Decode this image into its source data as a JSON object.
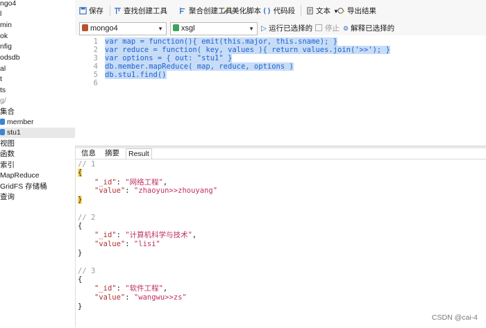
{
  "tree": {
    "items": [
      "ngo4",
      "l",
      "min",
      "ok",
      "nfig",
      "odsdb",
      "al",
      "t",
      "ts",
      "g/",
      "集合",
      "member",
      "stu1",
      "视图",
      "函数",
      "索引",
      "MapReduce",
      "GridFS 存储桶",
      "查询"
    ]
  },
  "toolbar": {
    "save": "保存",
    "find_builder": "查找创建工具",
    "aggregate_builder": "聚合创建工具",
    "beautify": "美化脚本",
    "code_snippet": "代码段",
    "text": "文本",
    "export": "导出结果"
  },
  "selectors": {
    "connection": "mongo4",
    "database": "xsgl",
    "run_selected": "运行已选择的",
    "stop": "停止",
    "explain_selected": "解释已选择的"
  },
  "editor": {
    "line_numbers": [
      "1",
      "2",
      "3",
      "4",
      "5",
      "6"
    ],
    "lines": [
      "var map = function(){ emit(this.major, this.sname); }",
      "var reduce = function( key, values ){ return values.join('>>'); }",
      "var options = { out: \"stu1\" }",
      "db.member.mapReduce( map, reduce, options )",
      "db.stu1.find()",
      ""
    ]
  },
  "result_tabs": [
    "信息",
    "摘要",
    "Result"
  ],
  "results": {
    "docs": [
      {
        "comment": "// 1",
        "id": "\"网络工程\"",
        "value": "\"zhaoyun>>zhouyang\""
      },
      {
        "comment": "// 2",
        "id": "\"计算机科学与技术\"",
        "value": "\"lisi\""
      },
      {
        "comment": "// 3",
        "id": "\"软件工程\"",
        "value": "\"wangwu>>zs\""
      }
    ],
    "id_key": "\"_id\"",
    "value_key": "\"value\"",
    "open_brace": "{",
    "close_brace": "}"
  },
  "watermark": "CSDN @cai-4"
}
